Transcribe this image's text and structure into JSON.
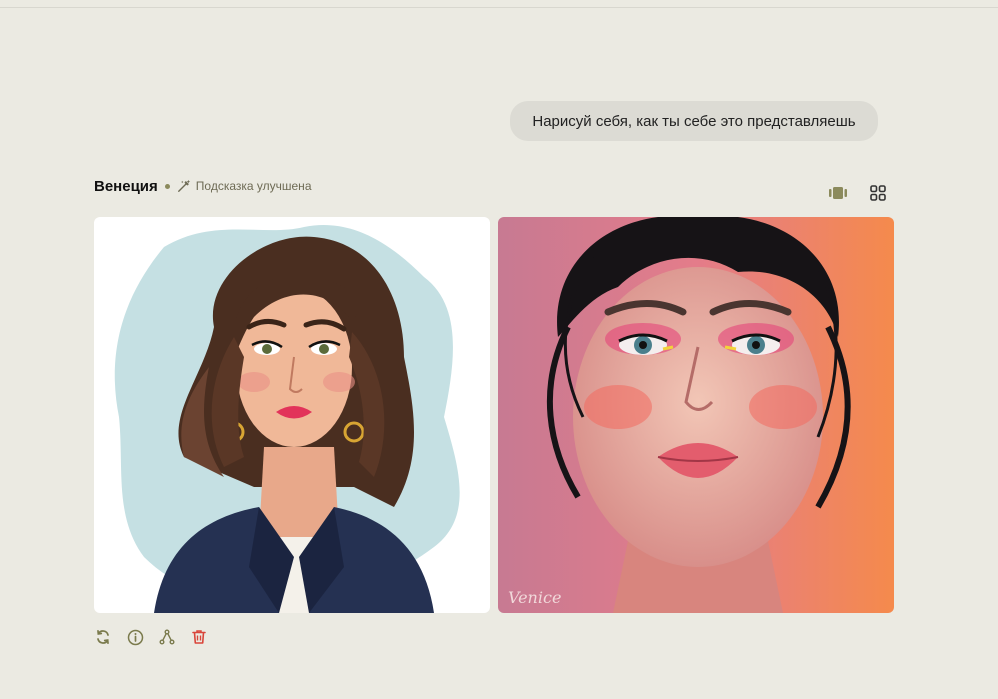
{
  "user_message": "Нарисуй себя, как ты себе это представляешь",
  "response": {
    "author": "Венеция",
    "prompt_status": "Подсказка улучшена"
  },
  "images": [
    {
      "icon": "illustrated-woman-portrait"
    },
    {
      "icon": "photoreal-woman-portrait",
      "signature": "Venice"
    }
  ],
  "view_toggle": [
    "carousel-icon",
    "grid-icon"
  ],
  "actions": [
    "regenerate-icon",
    "info-icon",
    "branch-icon",
    "trash-icon"
  ],
  "colors": {
    "background": "#ebeae2",
    "accent": "#8b8a5c",
    "delete": "#d9453a"
  }
}
